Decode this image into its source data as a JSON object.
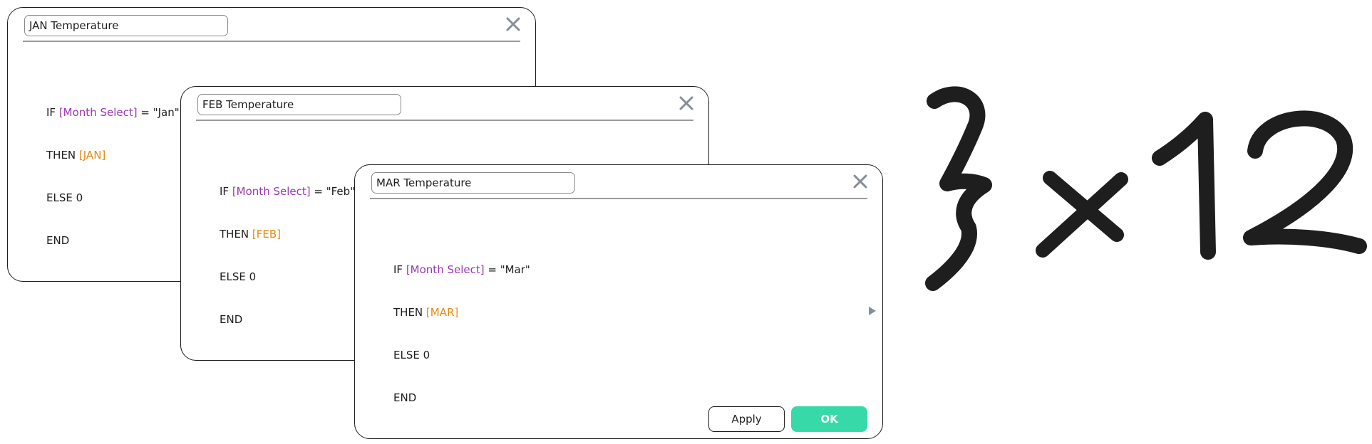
{
  "dialogs": [
    {
      "title": "JAN Temperature",
      "formula": {
        "if_kw": "IF ",
        "field": "[Month Select]",
        "eq": " = \"Jan\"",
        "then_kw": "THEN ",
        "value": "[JAN]",
        "else_line": "ELSE 0",
        "end_line": "END"
      }
    },
    {
      "title": "FEB Temperature",
      "formula": {
        "if_kw": "IF ",
        "field": "[Month Select]",
        "eq": " = \"Feb\"",
        "then_kw": "THEN ",
        "value": "[FEB]",
        "else_line": "ELSE 0",
        "end_line": "END"
      }
    },
    {
      "title": "MAR Temperature",
      "formula": {
        "if_kw": "IF ",
        "field": "[Month Select]",
        "eq": " = \"Mar\"",
        "then_kw": "THEN ",
        "value": "[MAR]",
        "else_line": "ELSE 0",
        "end_line": "END"
      },
      "buttons": {
        "apply_label": "Apply",
        "ok_label": "OK"
      }
    }
  ],
  "annotation": {
    "text": "3×12",
    "icon": "hand-drawn-text"
  },
  "icons": {
    "close": "close-icon",
    "expand": "arrow-right-icon"
  },
  "colors": {
    "field": "#9c36b5",
    "value": "#e8890c",
    "ok_button": "#38d9a9",
    "stroke": "#1e1e1e"
  }
}
